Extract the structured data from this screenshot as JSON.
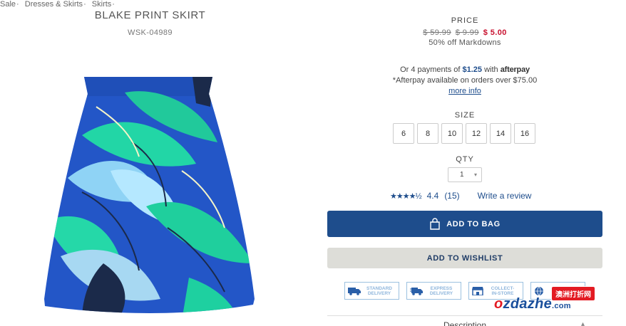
{
  "breadcrumb": {
    "items": [
      "Sale",
      "Dresses & Skirts",
      "Skirts"
    ],
    "separator": "·"
  },
  "product": {
    "title": "BLAKE PRINT SKIRT",
    "sku": "WSK-04989"
  },
  "price": {
    "heading": "PRICE",
    "original": "$ 59.99",
    "previous": "$ 9.99",
    "current": "$ 5.00",
    "markdown": "50% off Markdowns"
  },
  "afterpay": {
    "prefix": "Or 4 payments of",
    "amount": "$1.25",
    "with": "with",
    "logo": "afterpay",
    "note": "*Afterpay available on orders over $75.00",
    "more_info": "more info"
  },
  "size": {
    "label": "SIZE",
    "options": [
      "6",
      "8",
      "10",
      "12",
      "14",
      "16"
    ]
  },
  "qty": {
    "label": "QTY",
    "value": "1"
  },
  "rating": {
    "stars": "★★★★½",
    "score": "4.4",
    "count": "(15)",
    "write_review": "Write a review"
  },
  "buttons": {
    "add_to_bag": "ADD TO BAG",
    "add_to_wishlist": "ADD TO WISHLIST"
  },
  "delivery": [
    {
      "icon": "truck-icon",
      "line1": "STANDARD",
      "line2": "DELIVERY"
    },
    {
      "icon": "fast-truck-icon",
      "line1": "EXPRESS",
      "line2": "DELIVERY"
    },
    {
      "icon": "store-icon",
      "line1": "COLLECT-",
      "line2": "IN-STORE"
    },
    {
      "icon": "globe-icon",
      "line1": "",
      "line2": ""
    }
  ],
  "description": {
    "label": "Description"
  },
  "watermark": {
    "badge": "澳洲打折网",
    "text_o": "o",
    "text_main": "zdazhe",
    "text_dom": ".com"
  },
  "colors": {
    "brand_blue": "#1e4d8c",
    "sale_red": "#c8102e",
    "wishlist_bg": "#ddddd8"
  }
}
